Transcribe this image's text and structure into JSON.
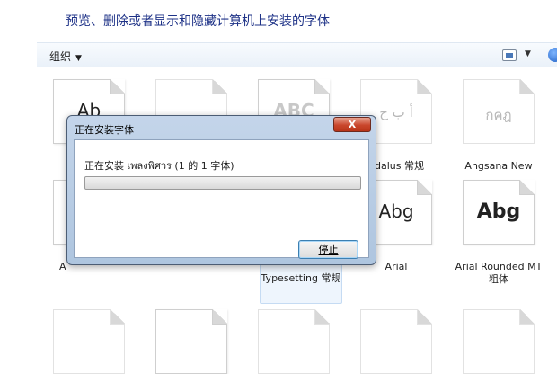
{
  "header": {
    "title": "预览、删除或者显示和隐藏计算机上安装的字体"
  },
  "toolbar": {
    "organize_label": "组织",
    "organize_caret": "▼",
    "view_caret": "▼"
  },
  "fonts": [
    {
      "label": "",
      "sample": "Ab"
    },
    {
      "label": "",
      "sample": ""
    },
    {
      "label": "",
      "sample": "ABC"
    },
    {
      "label": "ndalus 常规",
      "sample": "أ ب ج"
    },
    {
      "label": "Angsana New",
      "sample": "กคฎ"
    },
    {
      "label": "A",
      "sample": ""
    },
    {
      "label": "Typesetting 常规",
      "sample": ""
    },
    {
      "label": "Arial",
      "sample": "Abg"
    },
    {
      "label": "Arial Rounded MT 粗体",
      "sample": "Abg"
    }
  ],
  "dialog": {
    "title": "正在安装字体",
    "close_label": "X",
    "install_text": "正在安装 เพลงพิศวร (1 的 1 字体)",
    "progress": 0,
    "stop_label": "停止"
  }
}
